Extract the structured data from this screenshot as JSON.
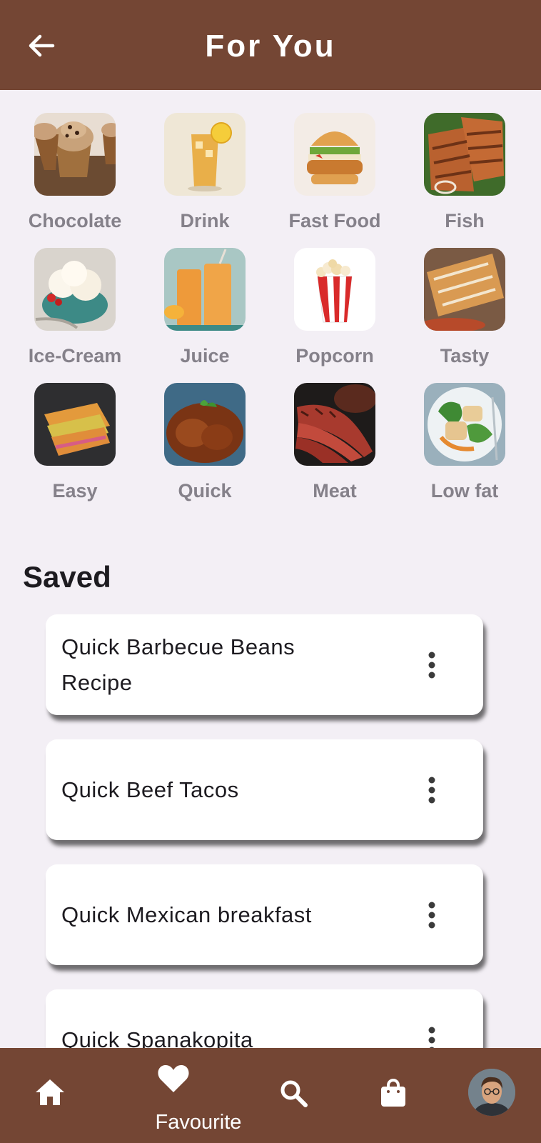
{
  "appbar": {
    "title": "For You"
  },
  "categories": [
    {
      "label": "Chocolate"
    },
    {
      "label": "Drink"
    },
    {
      "label": "Fast Food"
    },
    {
      "label": "Fish"
    },
    {
      "label": "Ice-Cream"
    },
    {
      "label": "Juice"
    },
    {
      "label": "Popcorn"
    },
    {
      "label": "Tasty"
    },
    {
      "label": "Easy"
    },
    {
      "label": "Quick"
    },
    {
      "label": "Meat"
    },
    {
      "label": "Low fat"
    }
  ],
  "saved": {
    "title": "Saved",
    "items": [
      {
        "title": "Quick Barbecue Beans Recipe"
      },
      {
        "title": "Quick Beef Tacos"
      },
      {
        "title": "Quick Mexican breakfast"
      },
      {
        "title": "Quick Spanakopita"
      }
    ]
  },
  "bottom_nav": {
    "active_label": "Favourite",
    "items": [
      "home-icon",
      "heart-icon",
      "search-icon",
      "shopping-bag-icon",
      "avatar"
    ]
  },
  "colors": {
    "brand": "#744634",
    "background": "#f3eff5",
    "label": "#85818a"
  }
}
